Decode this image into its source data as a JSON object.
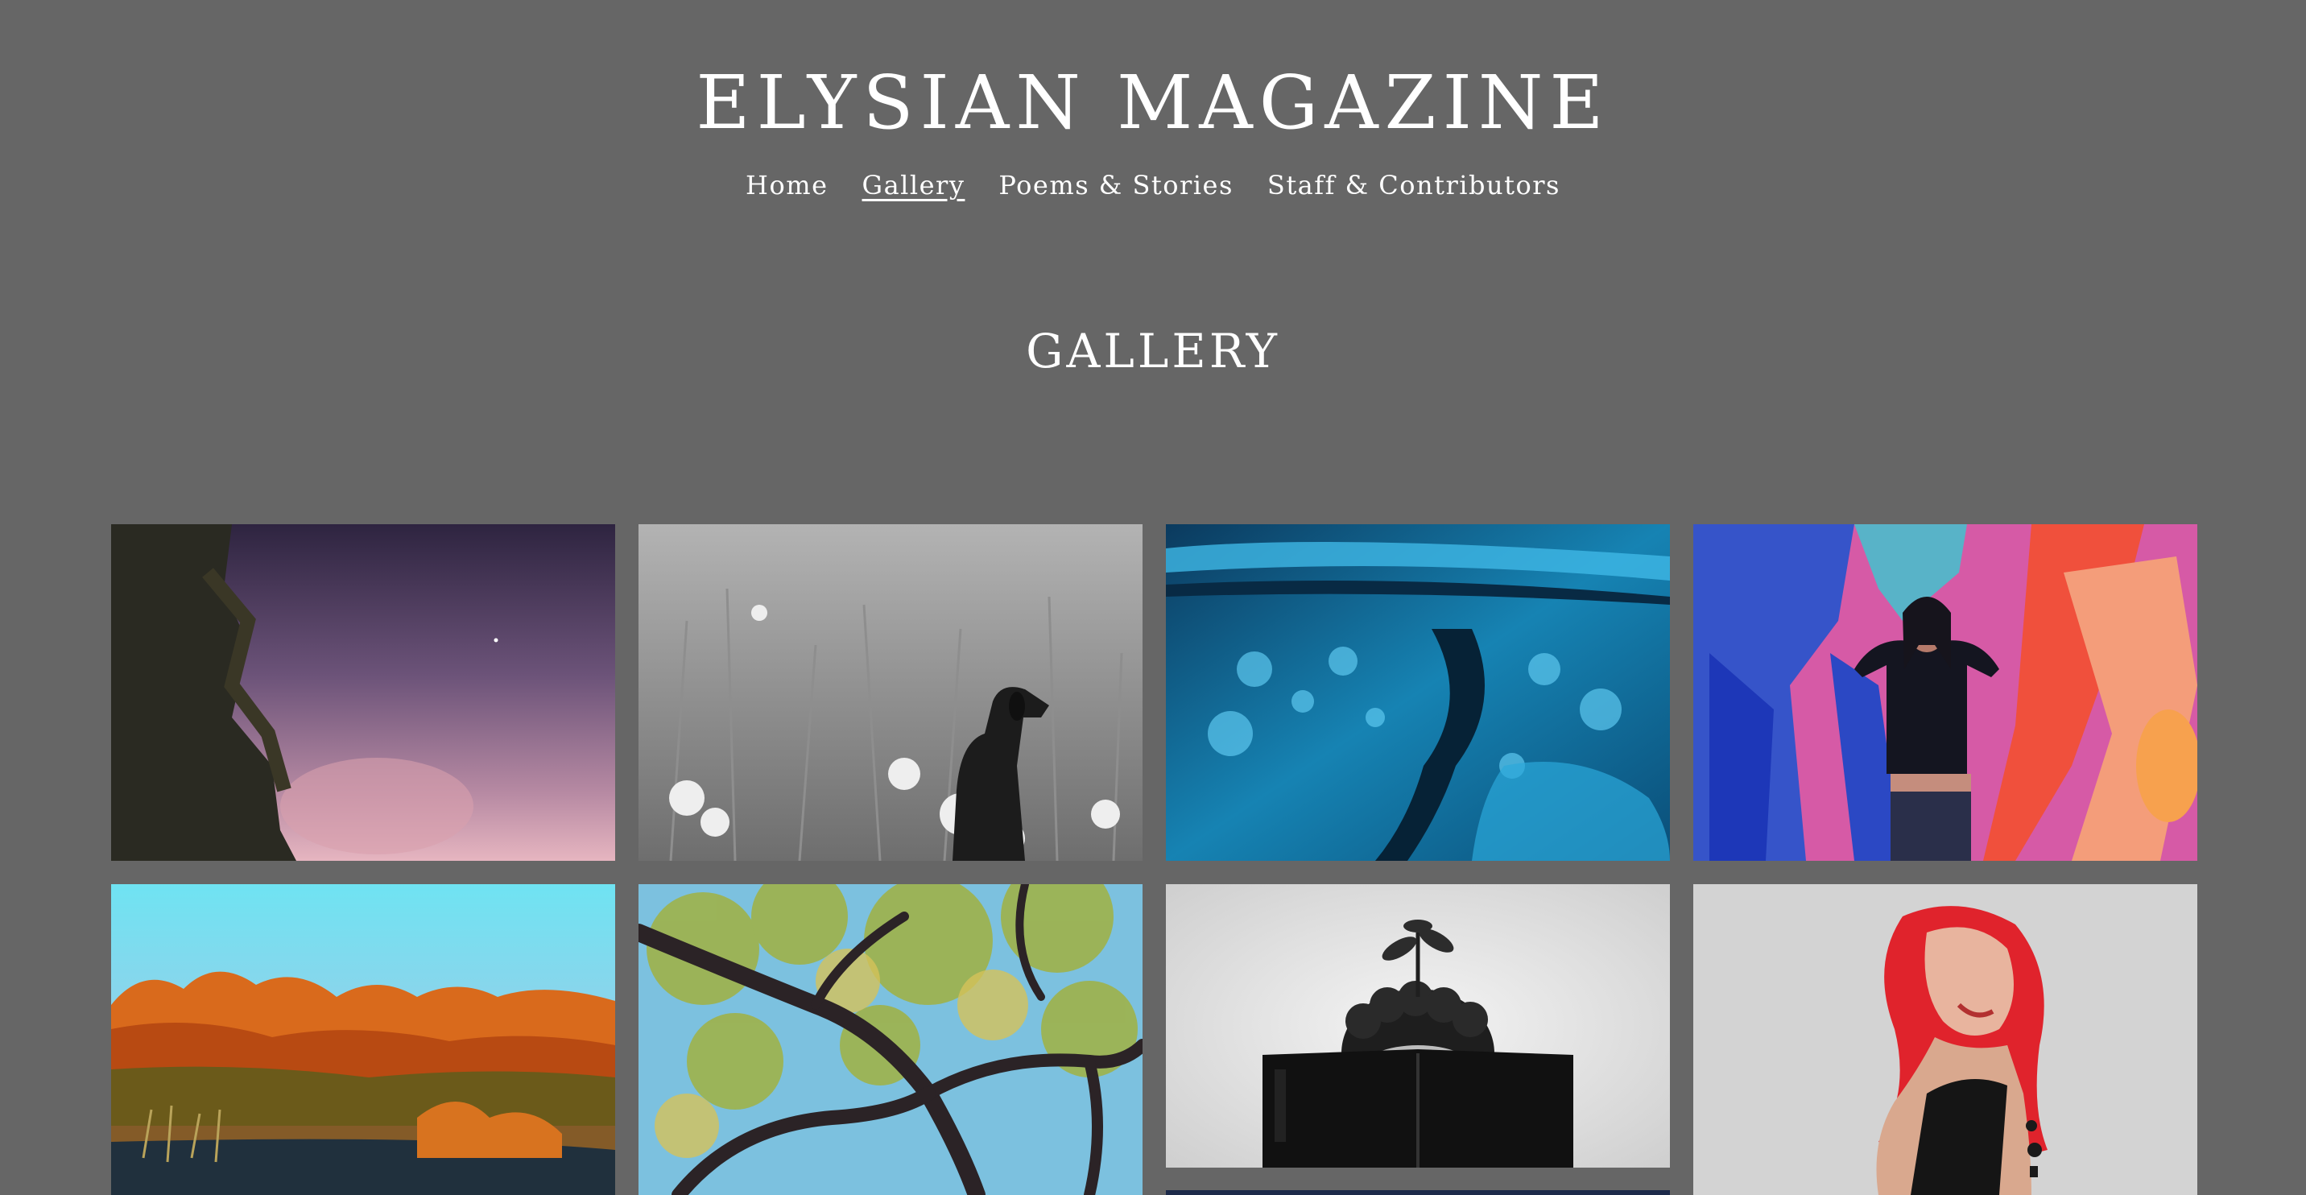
{
  "site": {
    "title": "ELYSIAN MAGAZINE"
  },
  "nav": {
    "items": [
      {
        "label": "Home",
        "active": false
      },
      {
        "label": "Gallery",
        "active": true
      },
      {
        "label": "Poems & Stories",
        "active": false
      },
      {
        "label": "Staff & Contributors",
        "active": false
      }
    ]
  },
  "page": {
    "heading": "GALLERY"
  },
  "colors": {
    "background": "#666666",
    "text": "#ffffff"
  },
  "gallery": {
    "images": [
      {
        "name": "twilight-sky-with-tree-image"
      },
      {
        "name": "black-dog-in-wildflowers-image"
      },
      {
        "name": "blue-fluid-art-image"
      },
      {
        "name": "woman-colorful-shadows-image"
      },
      {
        "name": "autumn-trees-by-water-image"
      },
      {
        "name": "painted-tree-branches-image"
      },
      {
        "name": "person-reading-book-with-plant-image"
      },
      {
        "name": "red-haired-woman-illustration-image"
      },
      {
        "name": "partial-dark-image"
      }
    ]
  }
}
